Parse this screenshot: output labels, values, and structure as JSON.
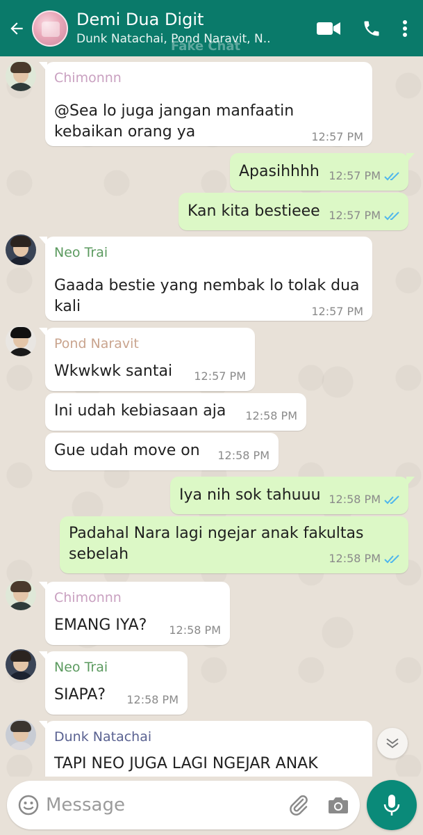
{
  "header": {
    "title": "Demi Dua Digit",
    "subtitle": "Dunk Natachai, Pond Naravit, N..",
    "watermark": "Fake Chat",
    "icons": [
      "back-arrow-icon",
      "video-call-icon",
      "phone-icon",
      "more-vert-icon"
    ],
    "color": "#0a7a6a"
  },
  "messages": [
    {
      "direction": "in",
      "sender": "Chimonnn",
      "sender_color": "#c9a0c0",
      "lines": [
        "@Sea lo juga jangan manfaatin",
        "kebaikan orang ya"
      ],
      "time": "12:57 PM"
    },
    {
      "direction": "out",
      "lines": [
        "Apasihhhh"
      ],
      "time": "12:57 PM",
      "status": "read"
    },
    {
      "direction": "out",
      "lines": [
        "Kan kita bestieee"
      ],
      "time": "12:57 PM",
      "status": "read"
    },
    {
      "direction": "in",
      "sender": "Neo Trai",
      "sender_color": "#5b9a5f",
      "lines": [
        "Gaada bestie yang nembak lo tolak dua",
        "kali"
      ],
      "time": "12:57 PM"
    },
    {
      "direction": "in",
      "sender": "Pond Naravit",
      "sender_color": "#c9a48e",
      "lines": [
        "Wkwkwk santai"
      ],
      "time": "12:57 PM"
    },
    {
      "direction": "in",
      "lines": [
        "Ini udah kebiasaan aja"
      ],
      "time": "12:58 PM"
    },
    {
      "direction": "in",
      "lines": [
        "Gue udah move on"
      ],
      "time": "12:58 PM"
    },
    {
      "direction": "out",
      "lines": [
        "Iya nih sok tahuuu"
      ],
      "time": "12:58 PM",
      "status": "read"
    },
    {
      "direction": "out",
      "lines": [
        "Padahal Nara lagi ngejar anak fakultas",
        "sebelah"
      ],
      "time": "12:58 PM",
      "status": "read"
    },
    {
      "direction": "in",
      "sender": "Chimonnn",
      "sender_color": "#c9a0c0",
      "lines": [
        "EMANG IYA?"
      ],
      "time": "12:58 PM"
    },
    {
      "direction": "in",
      "sender": "Neo Trai",
      "sender_color": "#5b9a5f",
      "lines": [
        "SIAPA?"
      ],
      "time": "12:58 PM"
    },
    {
      "direction": "in",
      "sender": "Dunk Natachai",
      "sender_color": "#5a6291",
      "lines": [
        "TAPI NEO JUGA LAGI NGEJAR ANAK"
      ],
      "time": ""
    }
  ],
  "composer": {
    "placeholder": "Message",
    "icons": [
      "emoji-icon",
      "attach-clip-icon",
      "camera-icon",
      "mic-icon"
    ]
  },
  "colors": {
    "incoming": "#ffffff",
    "outgoing": "#dcf8c6",
    "read_ticks": "#4fb6ec",
    "background": "#e8e1d8"
  }
}
